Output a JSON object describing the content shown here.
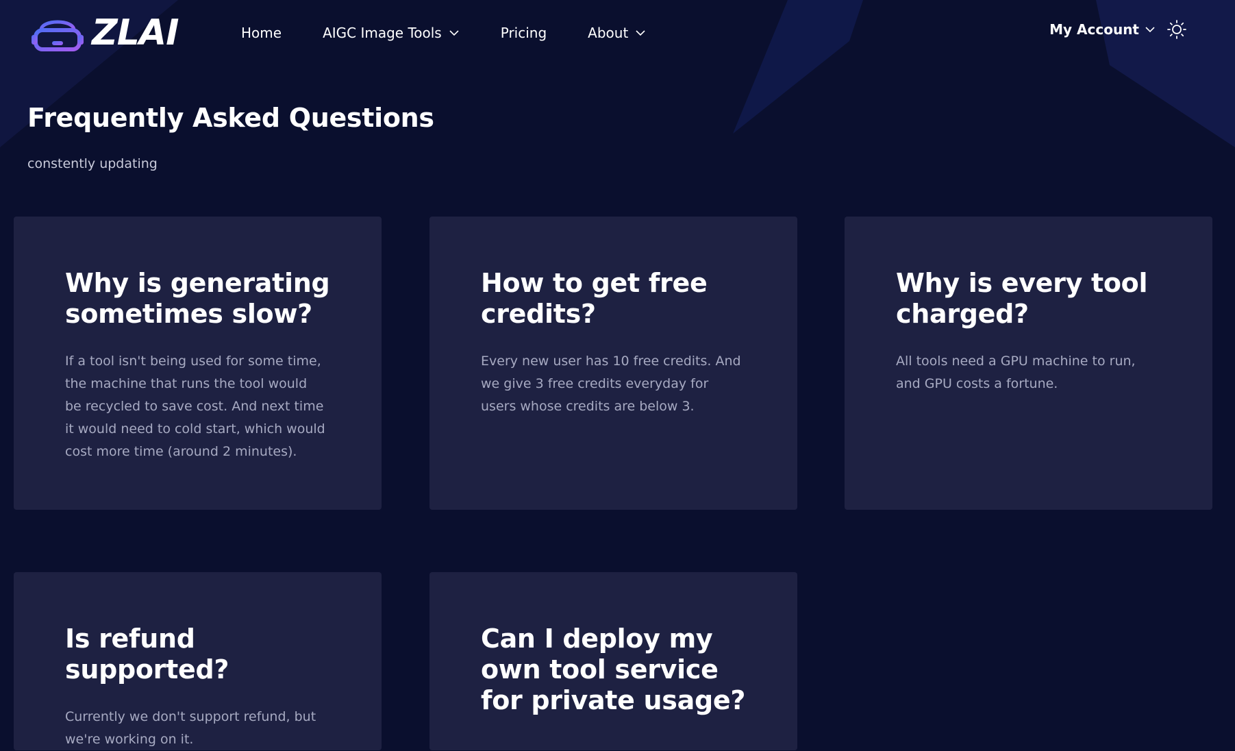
{
  "brand": {
    "name": "ZLAI",
    "colors": {
      "logo_gradient_start": "#4f6df5",
      "logo_gradient_end": "#a35cf0",
      "background": "#0a0f2e",
      "card": "#1e2142"
    }
  },
  "nav": {
    "items": [
      {
        "label": "Home",
        "has_dropdown": false
      },
      {
        "label": "AIGC Image Tools",
        "has_dropdown": true
      },
      {
        "label": "Pricing",
        "has_dropdown": false
      },
      {
        "label": "About",
        "has_dropdown": true
      }
    ],
    "account_label": "My Account",
    "theme_icon": "sun-icon"
  },
  "page": {
    "title": "Frequently Asked Questions",
    "subtitle": "constently updating"
  },
  "faq": [
    {
      "question": "Why is generating sometimes slow?",
      "answer": "If a tool isn't being used for some time, the machine that runs the tool would be recycled to save cost. And next time it would need to cold start, which would cost more time (around 2 minutes)."
    },
    {
      "question": "How to get free credits?",
      "answer": "Every new user has 10 free credits. And we give 3 free credits everyday for users whose credits are below 3."
    },
    {
      "question": "Why is every tool charged?",
      "answer": "All tools need a GPU machine to run, and GPU costs a fortune."
    },
    {
      "question": "Is refund supported?",
      "answer": "Currently we don't support refund, but we're working on it."
    },
    {
      "question": "Can I deploy my own tool service for private usage?",
      "answer": ""
    }
  ]
}
